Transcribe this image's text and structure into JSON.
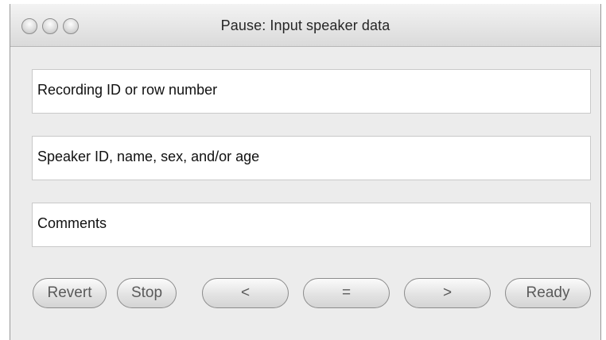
{
  "window": {
    "title": "Pause: Input speaker data"
  },
  "fields": {
    "recording": "Recording ID or row number",
    "speaker": "Speaker ID, name, sex, and/or age",
    "comments": "Comments"
  },
  "buttons": {
    "revert": "Revert",
    "stop": "Stop",
    "previous": "<",
    "equal": "=",
    "next": ">",
    "ready": "Ready"
  },
  "icons": {
    "close": "close-icon",
    "minimize": "minimize-icon",
    "zoom": "zoom-icon"
  }
}
